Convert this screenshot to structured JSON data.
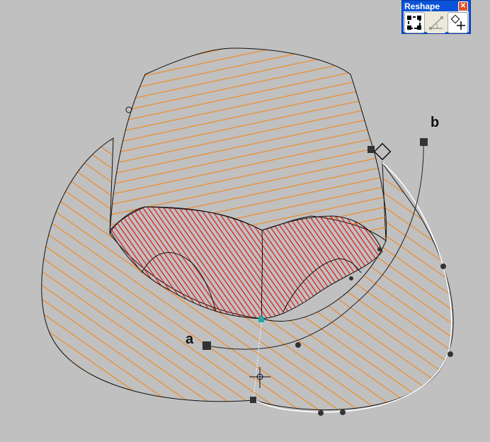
{
  "toolbar": {
    "title": "Reshape",
    "close_icon": "close-icon",
    "buttons": [
      {
        "name": "select-nodes",
        "icon": "node-select-icon",
        "enabled": true
      },
      {
        "name": "angle",
        "icon": "stitch-angle-icon",
        "enabled": false
      },
      {
        "name": "add-node",
        "icon": "add-node-icon",
        "enabled": true
      }
    ]
  },
  "labels": {
    "a": "a",
    "b": "b"
  },
  "colors": {
    "background": "#c0c0c0",
    "fill_stitch": "#f08a24",
    "satin_stitch": "#e01010",
    "outline": "#111111",
    "selected_outline": "#ffffff"
  }
}
